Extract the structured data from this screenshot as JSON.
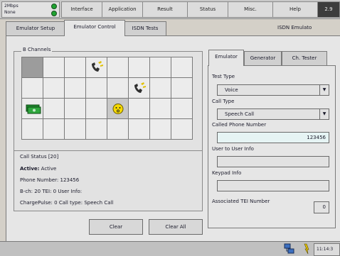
{
  "topbar": {
    "speed_line1": "2Mbps",
    "speed_line2": "None",
    "menu": [
      "Interface",
      "Application",
      "Result",
      "Status",
      "Misc.",
      "Help"
    ],
    "version": "2.9"
  },
  "tabs": [
    "Emulator Setup",
    "Emulator Control",
    "ISDN Tests"
  ],
  "section_title": "ISDN Emulato",
  "b_channels": {
    "title": "B Channels",
    "icons": {
      "phone_ringing": "phone-ringing-icon",
      "phone_ringing_2": "phone-ringing-icon",
      "money": "money-icon",
      "smiley": "smiley-icon"
    }
  },
  "call_status": {
    "title": "Call Status [20]",
    "active_label": "Active:",
    "active_value": "Active",
    "phone_line": "Phone Number: 123456",
    "bch_line": "B-ch: 20   TEI: 0   User Info:",
    "charge_line": "ChargePulse: 0   Call type: Speech Call"
  },
  "buttons": {
    "clear": "Clear",
    "clear_all": "Clear All"
  },
  "right_tabs": [
    "Emulator",
    "Generator",
    "Ch. Tester"
  ],
  "emulator": {
    "test_type_label": "Test Type",
    "test_type_value": "Voice",
    "call_type_label": "Call Type",
    "call_type_value": "Speech Call",
    "called_label": "Called Phone Number",
    "called_value": "123456",
    "u2u_label": "User to User Info",
    "u2u_value": "",
    "keypad_label": "Keypad Info",
    "keypad_value": "",
    "tei_label": "Associated TEI Number",
    "tei_value": "0"
  },
  "statusbar": {
    "clock": "11:14:3"
  },
  "colors": {
    "led": "#1fa331",
    "accent_field": "#e6f4f4"
  }
}
